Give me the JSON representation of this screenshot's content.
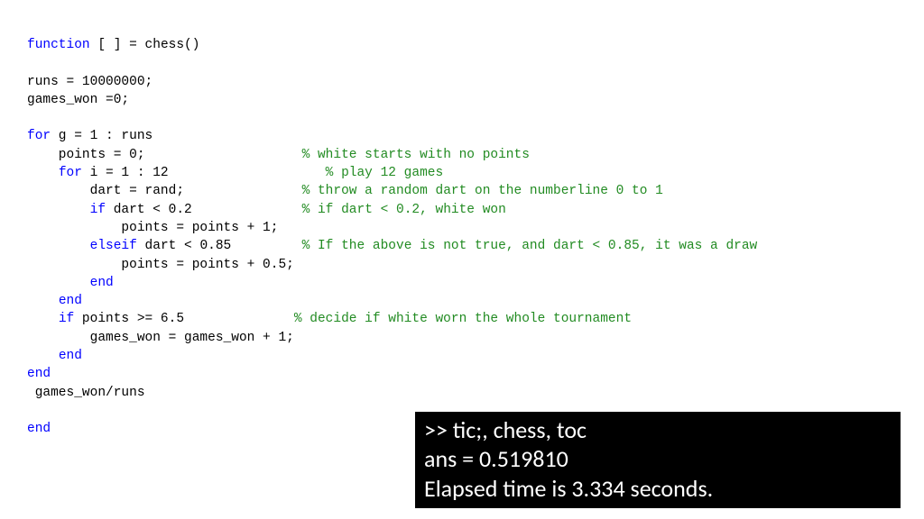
{
  "code": {
    "l01_kw": "function",
    "l01_rest": " [ ] = chess()",
    "l02": "",
    "l03": "runs = 10000000;",
    "l04": "games_won =0;",
    "l05": "",
    "l06_kw": "for",
    "l06_rest": " g = 1 : runs",
    "l07a": "    points = 0;                    ",
    "l07c": "% white starts with no points",
    "l08a": "    ",
    "l08kw": "for",
    "l08b": " i = 1 : 12                    ",
    "l08c": "% play 12 games",
    "l09a": "        dart = rand;               ",
    "l09c": "% throw a random dart on the numberline 0 to 1",
    "l10a": "        ",
    "l10kw": "if",
    "l10b": " dart < 0.2              ",
    "l10c": "% if dart < 0.2, white won",
    "l11": "            points = points + 1;",
    "l12a": "        ",
    "l12kw": "elseif",
    "l12b": " dart < 0.85         ",
    "l12c": "% If the above is not true, and dart < 0.85, it was a draw",
    "l13": "            points = points + 0.5;",
    "l14a": "        ",
    "l14kw": "end",
    "l15a": "    ",
    "l15kw": "end",
    "l16a": "    ",
    "l16kw": "if",
    "l16b": " points >= 6.5              ",
    "l16c": "% decide if white worn the whole tournament",
    "l17": "        games_won = games_won + 1;",
    "l18a": "    ",
    "l18kw": "end",
    "l19kw": "end",
    "l20": " games_won/runs",
    "l21": "",
    "l22kw": "end"
  },
  "console": {
    "line1": ">> tic;, chess, toc",
    "line2": "ans =   0.519810",
    "line3": "Elapsed time is 3.334 seconds."
  }
}
